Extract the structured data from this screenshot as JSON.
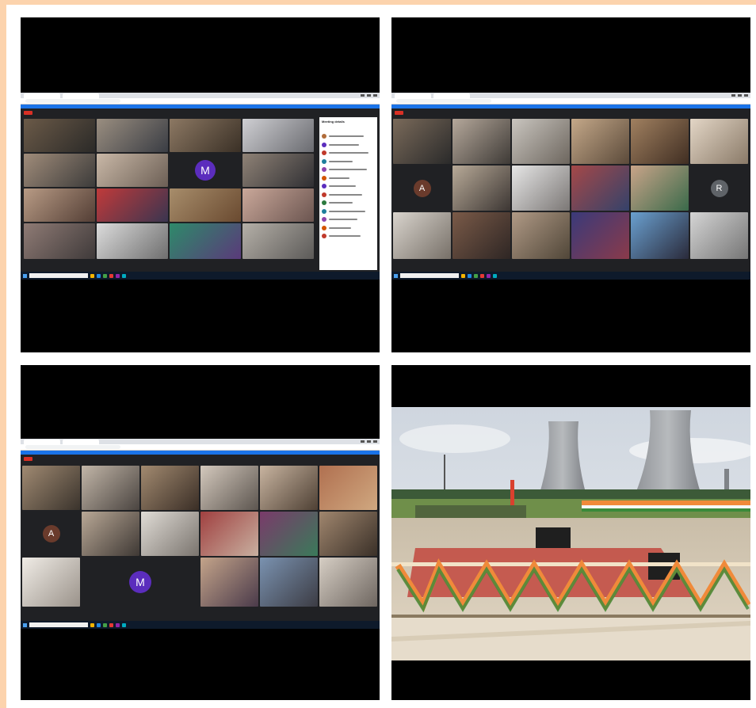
{
  "panels": {
    "tl": {
      "sidebar_title": "Meeting details",
      "avatars": [
        {
          "letter": "M",
          "color": "#5b2dbd"
        }
      ]
    },
    "tr": {
      "avatars": [
        {
          "letter": "A",
          "color": "#6a3b2c"
        },
        {
          "letter": "R",
          "color": "#5f6368"
        }
      ]
    },
    "bl": {
      "avatars": [
        {
          "letter": "A",
          "color": "#6a3b2c"
        },
        {
          "letter": "M",
          "color": "#5b2dbd"
        }
      ]
    }
  },
  "colors": {
    "page_border": "#fcd3ad",
    "meet_bg": "#202124",
    "taskbar": "#0e1a2b",
    "record": "#d93025"
  },
  "icons": [
    "windows-start-icon",
    "record-icon",
    "participant-avatar-icon"
  ]
}
